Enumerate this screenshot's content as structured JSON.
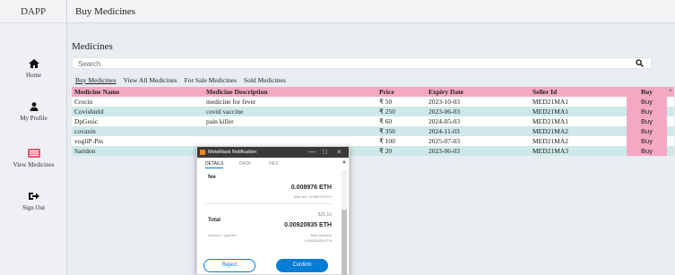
{
  "app": {
    "brand": "DAPP",
    "page_heading": "Buy Medicines"
  },
  "sidebar": {
    "items": [
      {
        "label": "Home",
        "icon": "home-icon"
      },
      {
        "label": "My Profile",
        "icon": "user-icon"
      },
      {
        "label": "View Medicines",
        "icon": "medicines-icon"
      },
      {
        "label": "Sign Out",
        "icon": "sign-out-icon"
      }
    ]
  },
  "main": {
    "title": "Medicines",
    "search": {
      "placeholder": "Search",
      "icon": "search-icon"
    },
    "tabs": [
      {
        "label": "Buy Medicines",
        "active": true
      },
      {
        "label": "View All Medicines",
        "active": false
      },
      {
        "label": "For Sale Medicines",
        "active": false
      },
      {
        "label": "Sold Medicines",
        "active": false
      }
    ],
    "table": {
      "headers": [
        "Medicine Name",
        "Medicine Description",
        "Price",
        "Expiry Date",
        "Seller Id",
        "Buy"
      ],
      "rows": [
        {
          "name": "Crocin",
          "description": "medicine for fever",
          "price": "₹ 50",
          "expiry": "2023-10-03",
          "seller": "MED21MA1",
          "buy": "Buy"
        },
        {
          "name": "Covishield",
          "description": "covid vaccine",
          "price": "₹ 250",
          "expiry": "2023-06-03",
          "seller": "MED21MA1",
          "buy": "Buy"
        },
        {
          "name": "DpGesic",
          "description": "pain killer",
          "price": "₹ 60",
          "expiry": "2024-05-03",
          "seller": "MED21MA1",
          "buy": "Buy"
        },
        {
          "name": "covaxin",
          "description": "",
          "price": "₹ 350",
          "expiry": "2024-11-03",
          "seller": "MED21MA2",
          "buy": "Buy"
        },
        {
          "name": "vogliP-Pm",
          "description": "",
          "price": "₹ 100",
          "expiry": "2025-07-03",
          "seller": "MED21MA2",
          "buy": "Buy"
        },
        {
          "name": "Saridon",
          "description": "",
          "price": "₹ 20",
          "expiry": "2023-06-03",
          "seller": "MED21MA3",
          "buy": "Buy"
        }
      ]
    }
  },
  "metamask": {
    "title": "MetaMask Notification",
    "controls": [
      "—",
      "□",
      "×"
    ],
    "tabs": [
      "DETAILS",
      "DATA",
      "HEX"
    ],
    "fee_label": "fee",
    "fee_eth": "0.008976 ETH",
    "max_fee": "Max fee: 0.008976 ETH",
    "total_label": "Total",
    "total_usd": "$26.10",
    "total_eth": "0.00920835 ETH",
    "amount_gas_label": "Amount + gas fee",
    "max_amount_label": "Max amount:",
    "max_amount": "0.00920835 ETH",
    "reject": "Reject",
    "confirm": "Confirm"
  },
  "colors": {
    "header_pink": "#f4a8c4",
    "row_teal": "#cfe8e9",
    "metamask_blue": "#037dd6"
  }
}
